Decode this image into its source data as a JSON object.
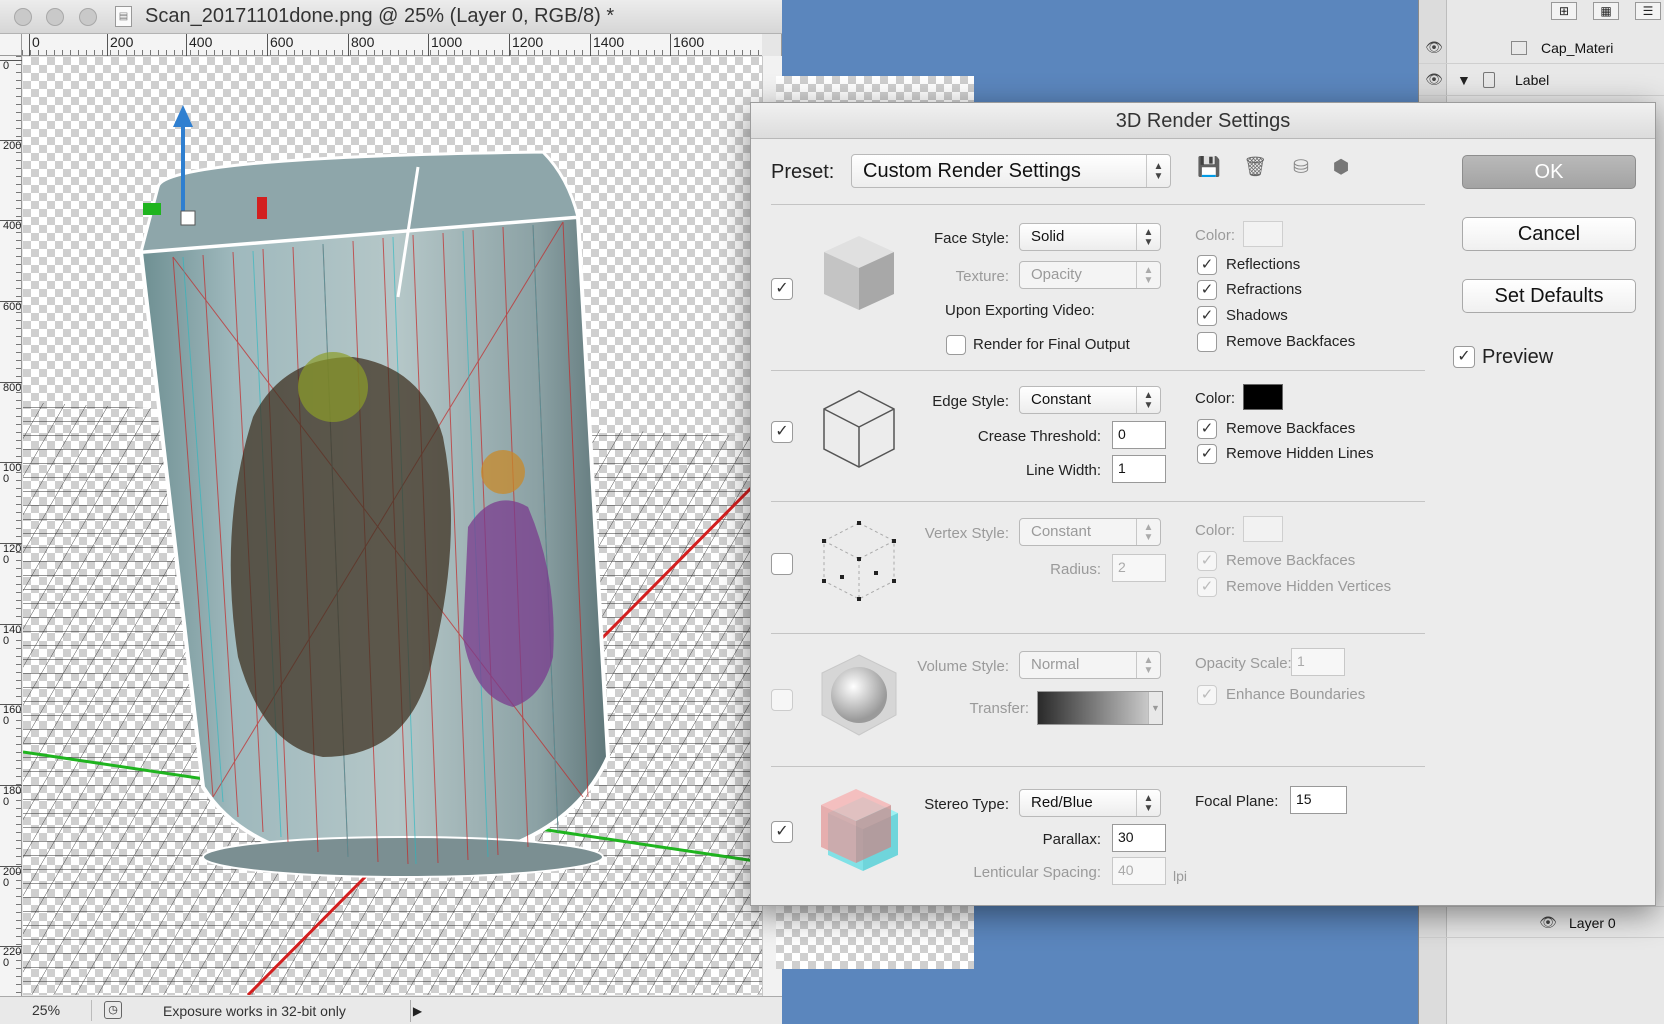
{
  "document": {
    "title": "Scan_20171101done.png @ 25% (Layer 0, RGB/8) *",
    "ruler_h": [
      "0",
      "200",
      "400",
      "600",
      "800",
      "1000",
      "1200",
      "1400",
      "1600"
    ],
    "ruler_v": [
      "0",
      "200",
      "400",
      "600",
      "800",
      "1000",
      "1200",
      "1400",
      "1600",
      "1800",
      "2000",
      "2200"
    ],
    "zoom": "25%",
    "status": "Exposure works in 32-bit only",
    "icons": [
      "document-icon",
      "clock-icon",
      "play-arrow-icon"
    ]
  },
  "layers": {
    "rows": [
      {
        "name": "Cap_Materi"
      },
      {
        "name": "Label"
      },
      {
        "name": "Layer 0"
      }
    ],
    "eye_glyph": "👁"
  },
  "dialog": {
    "title": "3D Render Settings",
    "preset_label": "Preset:",
    "preset_value": "Custom Render Settings",
    "buttons": {
      "ok": "OK",
      "cancel": "Cancel",
      "set_defaults": "Set Defaults"
    },
    "preview_label": "Preview",
    "face": {
      "style_label": "Face Style:",
      "style_value": "Solid",
      "texture_label": "Texture:",
      "texture_value": "Opacity",
      "export_label": "Upon Exporting Video:",
      "render_final_label": "Render for Final Output",
      "color_label": "Color:",
      "checks": [
        "Reflections",
        "Refractions",
        "Shadows",
        "Remove Backfaces"
      ]
    },
    "edge": {
      "style_label": "Edge Style:",
      "style_value": "Constant",
      "crease_label": "Crease Threshold:",
      "crease_value": "0",
      "width_label": "Line Width:",
      "width_value": "1",
      "color_label": "Color:",
      "color": "#000000",
      "checks": [
        "Remove Backfaces",
        "Remove Hidden Lines"
      ]
    },
    "vertex": {
      "style_label": "Vertex Style:",
      "style_value": "Constant",
      "radius_label": "Radius:",
      "radius_value": "2",
      "color_label": "Color:",
      "checks": [
        "Remove Backfaces",
        "Remove Hidden Vertices"
      ]
    },
    "volume": {
      "style_label": "Volume Style:",
      "style_value": "Normal",
      "transfer_label": "Transfer:",
      "opacity_label": "Opacity Scale:",
      "opacity_value": "1",
      "checks": [
        "Enhance Boundaries"
      ]
    },
    "stereo": {
      "type_label": "Stereo Type:",
      "type_value": "Red/Blue",
      "parallax_label": "Parallax:",
      "parallax_value": "30",
      "lenticular_label": "Lenticular Spacing:",
      "lenticular_value": "40",
      "lenticular_unit": "lpi",
      "focal_label": "Focal Plane:",
      "focal_value": "15"
    },
    "check_glyph": "✓"
  },
  "colors": {
    "desktop": "#5b86bd",
    "ok_button": "#a8a8a8",
    "axis_red": "#d31f1f",
    "axis_green": "#1fb41f",
    "axis_blue": "#2f7fd0"
  }
}
